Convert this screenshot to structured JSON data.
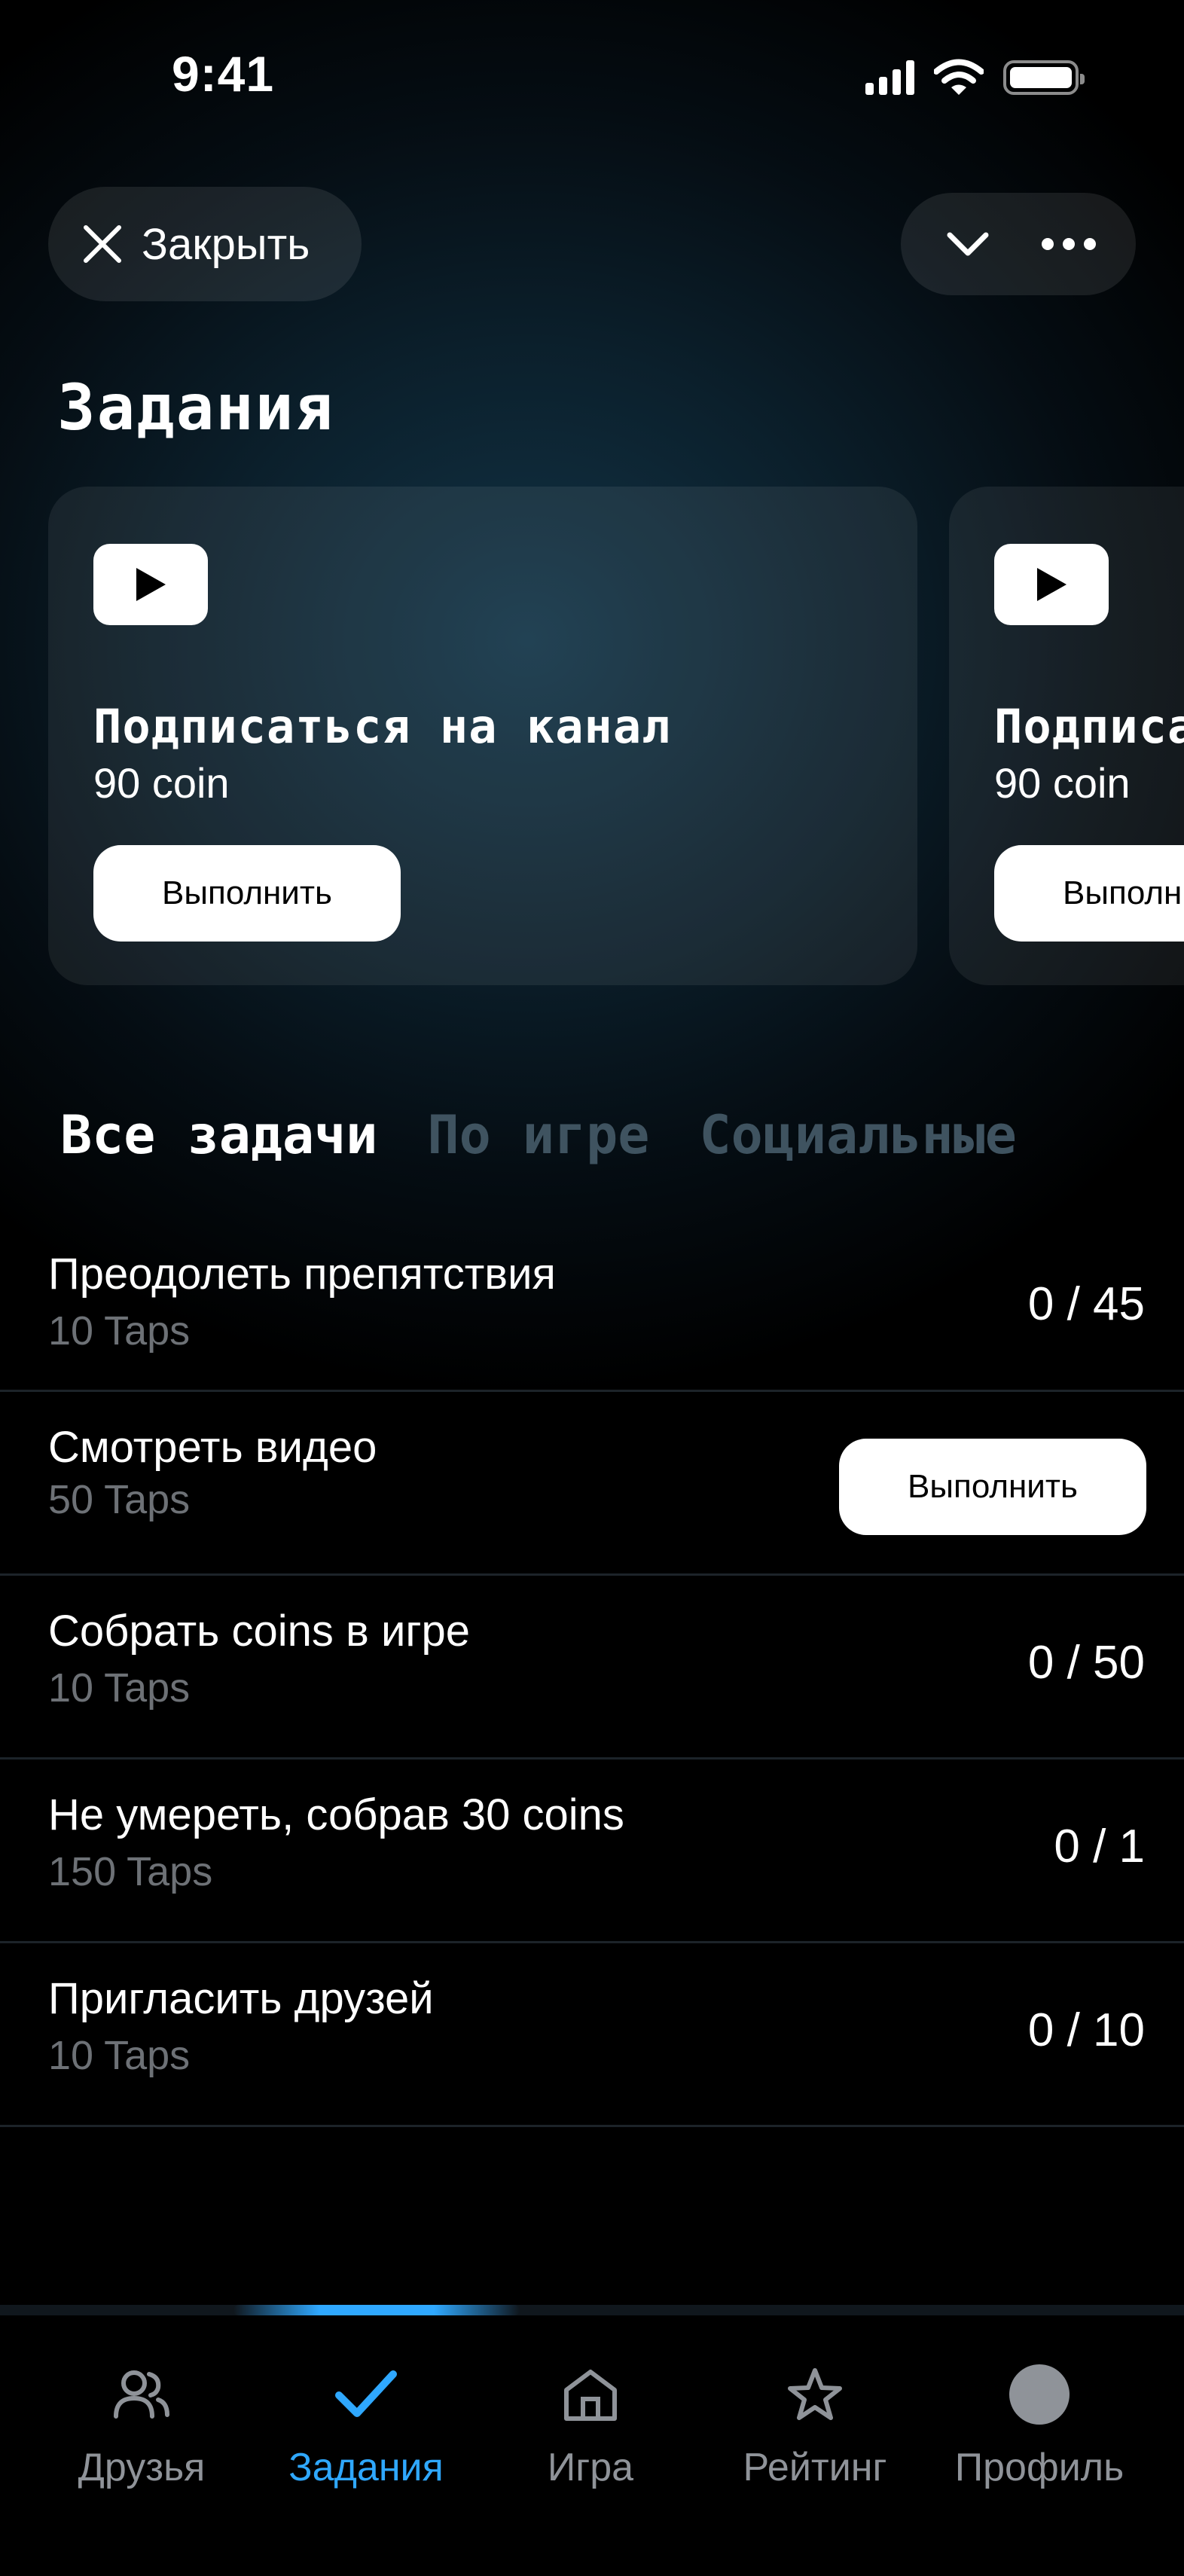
{
  "status_bar": {
    "time": "9:41"
  },
  "header": {
    "close_label": "Закрыть",
    "page_title": "Задания"
  },
  "featured_tasks": [
    {
      "title": "Подписаться на канал",
      "reward": "90 coin",
      "button_label": "Выполнить"
    },
    {
      "title": "Подписаться на канал",
      "reward": "90 coin",
      "button_label": "Выполнить"
    }
  ],
  "filter_tabs": [
    {
      "label": "Все задачи",
      "active": true
    },
    {
      "label": "По игре",
      "active": false
    },
    {
      "label": "Социальные",
      "active": false
    }
  ],
  "tasks": [
    {
      "name": "Преодолеть препятствия",
      "reward": "10 Taps",
      "progress": "0 / 45"
    },
    {
      "name": "Смотреть видео",
      "reward": "50 Taps",
      "button_label": "Выполнить"
    },
    {
      "name": "Собрать coins в игре",
      "reward": "10 Taps",
      "progress": "0 / 50"
    },
    {
      "name": "Не умереть, собрав 30 coins",
      "reward": "150 Taps",
      "progress": "0 / 1"
    },
    {
      "name": "Пригласить друзей",
      "reward": "10 Taps",
      "progress": "0 / 10"
    }
  ],
  "bottom_nav": [
    {
      "label": "Друзья",
      "icon": "friends-icon",
      "active": false
    },
    {
      "label": "Задания",
      "icon": "check-icon",
      "active": true
    },
    {
      "label": "Игра",
      "icon": "home-icon",
      "active": false
    },
    {
      "label": "Рейтинг",
      "icon": "star-icon",
      "active": false
    },
    {
      "label": "Профиль",
      "icon": "avatar",
      "active": false
    }
  ],
  "colors": {
    "accent": "#2fa8ff",
    "background": "#000000",
    "inactive_tab": "#3f5360",
    "muted_text": "#6d7176"
  }
}
